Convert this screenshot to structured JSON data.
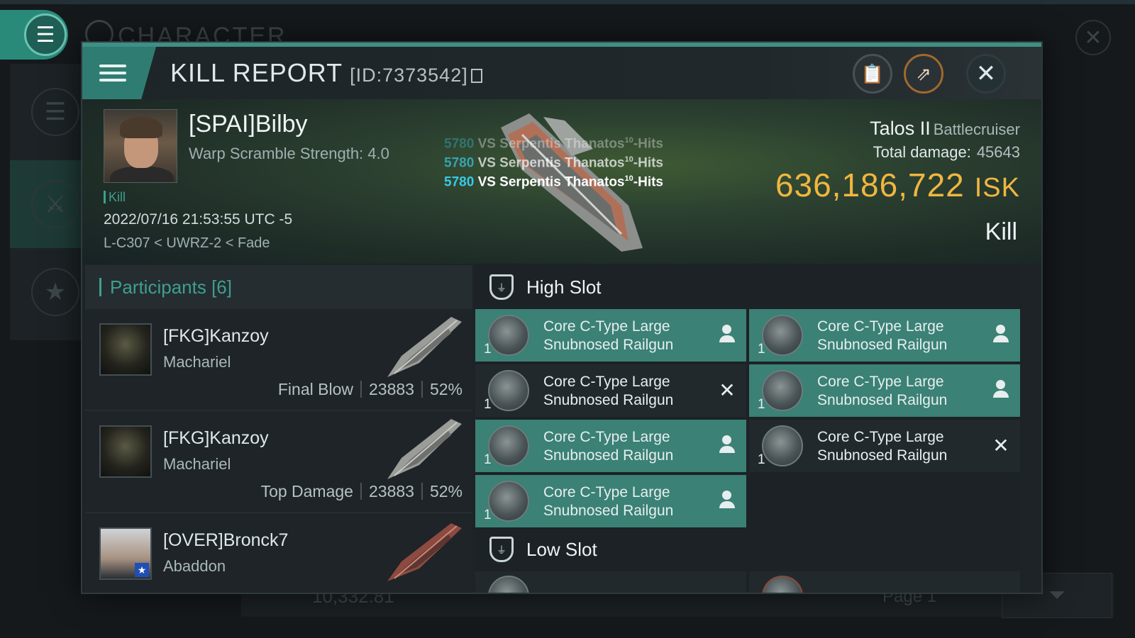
{
  "background": {
    "header_title": "CHARACTER",
    "bottom_value": "10,332.81",
    "page_label": "Page 1"
  },
  "modal": {
    "title": "KILL REPORT",
    "id_text": "[ID:7373542]"
  },
  "victim": {
    "name": "[SPAI]Bilby",
    "warp_scramble": "Warp Scramble Strength: 4.0",
    "tag": "Kill",
    "datetime": "2022/07/16 21:53:55 UTC -5",
    "location": "L-C307 < UWRZ-2 < Fade"
  },
  "hits": [
    {
      "value": "5780",
      "text": "VS Serpentis Thanatos",
      "sup": "10",
      "suffix": "-Hits"
    },
    {
      "value": "5780",
      "text": "VS Serpentis Thanatos",
      "sup": "10",
      "suffix": "-Hits"
    },
    {
      "value": "5780",
      "text": "VS Serpentis Thanatos",
      "sup": "10",
      "suffix": "-Hits"
    }
  ],
  "summary": {
    "ship_name": "Talos II",
    "ship_class": "Battlecruiser",
    "total_damage_label": "Total damage:",
    "total_damage_value": "45643",
    "isk_value": "636,186,722",
    "isk_unit": "ISK",
    "result": "Kill"
  },
  "participants": {
    "header": "Participants [6]",
    "list": [
      {
        "name": "[FKG]Kanzoy",
        "ship": "Machariel",
        "role": "Final Blow",
        "damage": "23883",
        "percent": "52%"
      },
      {
        "name": "[FKG]Kanzoy",
        "ship": "Machariel",
        "role": "Top Damage",
        "damage": "23883",
        "percent": "52%"
      },
      {
        "name": "[OVER]Bronck7",
        "ship": "Abaddon",
        "role": "",
        "damage": "",
        "percent": ""
      }
    ]
  },
  "slots": {
    "high_label": "High Slot",
    "low_label": "Low Slot",
    "high_items": [
      {
        "qty": "1",
        "line1": "Core C-Type Large",
        "line2": "Snubnosed Railgun",
        "state": "dropped"
      },
      {
        "qty": "1",
        "line1": "Core C-Type Large",
        "line2": "Snubnosed Railgun",
        "state": "dropped"
      },
      {
        "qty": "1",
        "line1": "Core C-Type Large",
        "line2": "Snubnosed Railgun",
        "state": "destroyed"
      },
      {
        "qty": "1",
        "line1": "Core C-Type Large",
        "line2": "Snubnosed Railgun",
        "state": "dropped"
      },
      {
        "qty": "1",
        "line1": "Core C-Type Large",
        "line2": "Snubnosed Railgun",
        "state": "dropped"
      },
      {
        "qty": "1",
        "line1": "Core C-Type Large",
        "line2": "Snubnosed Railgun",
        "state": "destroyed"
      },
      {
        "qty": "1",
        "line1": "Core C-Type Large",
        "line2": "Snubnosed Railgun",
        "state": "dropped"
      }
    ]
  },
  "colors": {
    "accent_teal": "#3f9f8e",
    "fitted_teal": "#3b8175",
    "isk_gold": "#f0b640",
    "hit_number": "#38c9e6"
  }
}
